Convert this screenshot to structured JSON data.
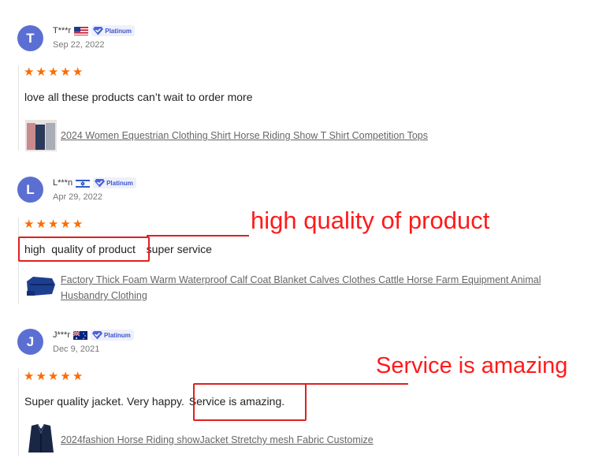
{
  "reviews": [
    {
      "initial": "T",
      "name": "T***r",
      "country_flag": "us-flag",
      "badge": "Platinum",
      "date": "Sep 22, 2022",
      "rating": 5,
      "text": "love all these products can’t wait to order more",
      "product": "2024 Women Equestrian Clothing Shirt Horse Riding Show T Shirt Competition Tops"
    },
    {
      "initial": "L",
      "name": "L***n",
      "country_flag": "il-flag",
      "badge": "Platinum",
      "date": "Apr 29, 2022",
      "rating": 5,
      "text_highlight": "high  quality of product",
      "text_rest": "super service",
      "product_line1": "Factory Thick Foam Warm Waterproof Calf Coat Blanket Calves Clothes Cattle Horse Farm Equipment Animal",
      "product_line2": "Husbandry Clothing"
    },
    {
      "initial": "J",
      "name": "J***r",
      "country_flag": "au-flag",
      "badge": "Platinum",
      "date": "Dec 9, 2021",
      "rating": 5,
      "text_before": "Super quality jacket. Very happy.",
      "text_highlight": "Service is amazing.",
      "product": "2024fashion Horse Riding showJacket Stretchy mesh Fabric Customize"
    }
  ],
  "annotations": {
    "first": "high quality of product",
    "second": "Service is amazing"
  },
  "colors": {
    "star": "#ff6a00",
    "avatar": "#5b6fd3",
    "annotation": "#e02020"
  }
}
